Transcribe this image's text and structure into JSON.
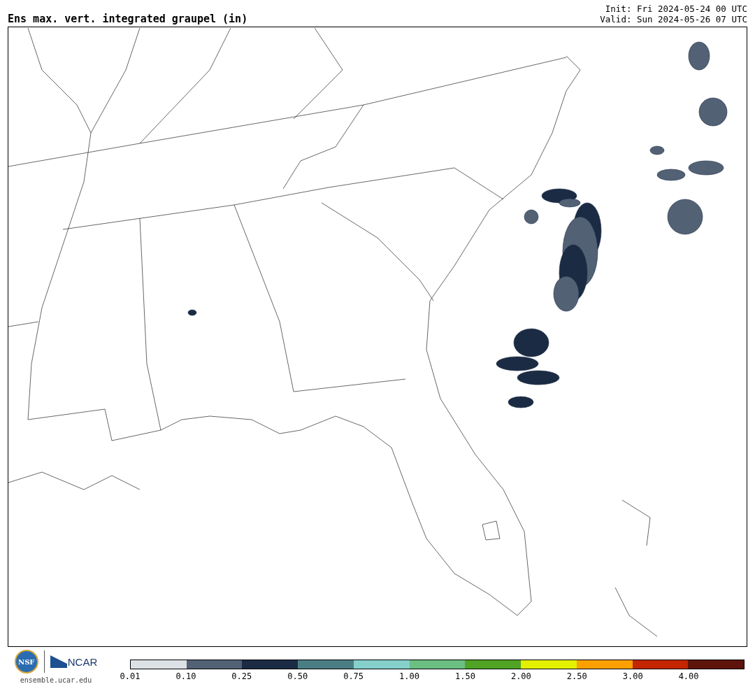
{
  "title": "Ens max. vert. integrated graupel (in)",
  "init": "Init: Fri 2024-05-24 00 UTC",
  "valid": "Valid: Sun 2024-05-26 07 UTC",
  "logos": {
    "nsf": "NSF",
    "ncar": "NCAR",
    "url": "ensemble.ucar.edu"
  },
  "colorbar": {
    "bins": [
      {
        "color": "#dce1e5"
      },
      {
        "color": "#536175"
      },
      {
        "color": "#1b2b44"
      },
      {
        "color": "#4a7e84"
      },
      {
        "color": "#86d0cc"
      },
      {
        "color": "#6bbf82"
      },
      {
        "color": "#50a324"
      },
      {
        "color": "#e3f000"
      },
      {
        "color": "#fea000"
      },
      {
        "color": "#c42601"
      },
      {
        "color": "#5e140a"
      }
    ],
    "labels": [
      "0.01",
      "0.10",
      "0.25",
      "0.50",
      "0.75",
      "1.00",
      "1.50",
      "2.00",
      "2.50",
      "3.00",
      "4.00"
    ]
  }
}
